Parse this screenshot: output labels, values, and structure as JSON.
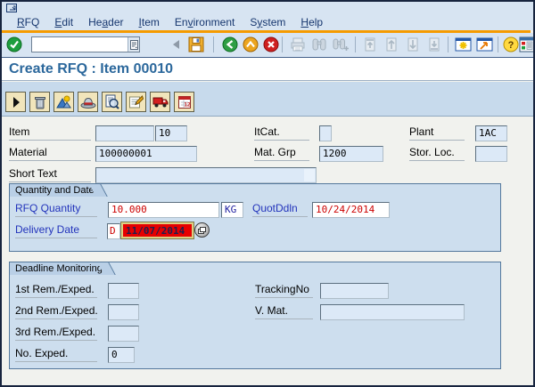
{
  "menu": {
    "items": [
      {
        "label": "RFQ",
        "u": 0
      },
      {
        "label": "Edit",
        "u": 0
      },
      {
        "label": "Header",
        "u": 2
      },
      {
        "label": "Item",
        "u": 0
      },
      {
        "label": "Environment",
        "u": 2
      },
      {
        "label": "System",
        "u": 1
      },
      {
        "label": "Help",
        "u": 0
      }
    ]
  },
  "standard_toolbar": {
    "command_value": "",
    "buttons": [
      "enter",
      "command-field",
      "hide-command-field",
      "save",
      "back",
      "exit",
      "cancel",
      "print",
      "find",
      "find-next",
      "first-page",
      "previous-page",
      "next-page",
      "last-page",
      "new-session",
      "create-shortcut",
      "help",
      "customize-layout"
    ]
  },
  "title_bar": {
    "title": "Create RFQ : Item 00010"
  },
  "app_toolbar": {
    "buttons": [
      "next-item",
      "delete",
      "material",
      "header-details",
      "item-details",
      "item-text",
      "delivery-address",
      "delivery-schedule"
    ]
  },
  "form": {
    "item": {
      "label": "Item",
      "value1": "",
      "value2": "10"
    },
    "itcat": {
      "label": "ItCat.",
      "value": ""
    },
    "plant": {
      "label": "Plant",
      "value": "1AC"
    },
    "material": {
      "label": "Material",
      "value": "100000001"
    },
    "matgrp": {
      "label": "Mat. Grp",
      "value": "1200"
    },
    "storloc": {
      "label": "Stor. Loc.",
      "value": ""
    },
    "shorttext": {
      "label": "Short Text",
      "value": ""
    }
  },
  "quantity_date": {
    "group_title": "Quantity and Date",
    "rfq_quantity": {
      "label": "RFQ Quantity",
      "value": "10.000",
      "unit": "KG"
    },
    "quot_ddln": {
      "label": "QuotDdln",
      "value": "10/24/2014"
    },
    "delivery_date": {
      "label": "Delivery Date",
      "category": "D",
      "value": "11/07/2014"
    }
  },
  "deadline_monitoring": {
    "group_title": "Deadline Monitoring",
    "rem1": {
      "label": "1st Rem./Exped.",
      "value": ""
    },
    "rem2": {
      "label": "2nd Rem./Exped.",
      "value": ""
    },
    "rem3": {
      "label": "3rd Rem./Exped.",
      "value": ""
    },
    "no_exped": {
      "label": "No. Exped.",
      "value": "0"
    },
    "tracking": {
      "label": "TrackingNo",
      "value": ""
    },
    "vmat": {
      "label": "V. Mat.",
      "value": ""
    }
  },
  "colors": {
    "accent_orange": "#F59B00",
    "chrome_blue": "#D7E4F2",
    "group_blue": "#CDDEEE",
    "field_blue": "#DCE9F7",
    "error_red": "#E60000",
    "value_red": "#CC0000",
    "title_blue": "#2C689C",
    "label_blue": "#2233BB"
  }
}
